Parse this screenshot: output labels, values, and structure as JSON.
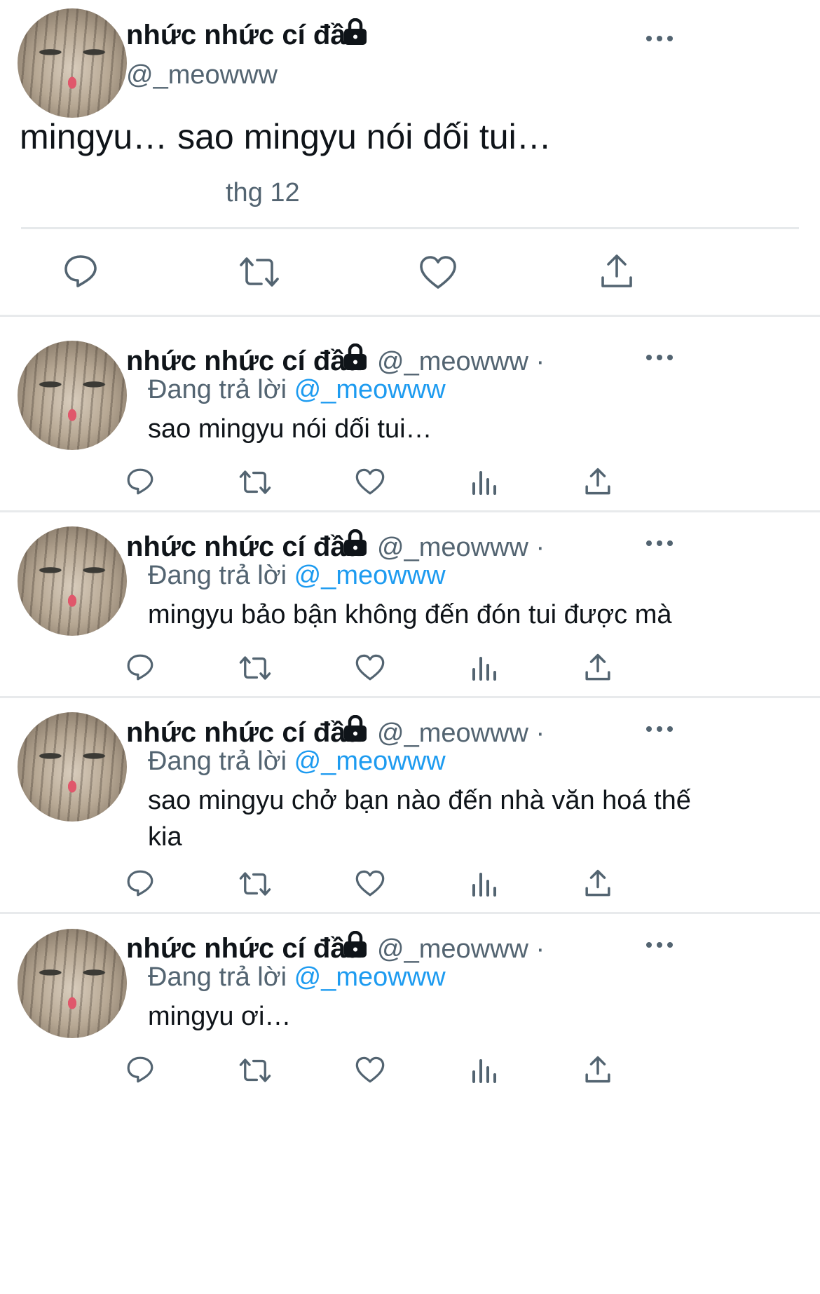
{
  "main_tweet": {
    "display_name": "nhức nhức cí đầu",
    "handle": "@_meowww",
    "text": "mingyu… sao mingyu nói dối tui…",
    "date": "thg 12"
  },
  "icons": {
    "reply": "reply-icon",
    "retweet": "retweet-icon",
    "like": "like-icon",
    "analytics": "analytics-icon",
    "share": "share-icon",
    "more": "more-icon",
    "lock": "lock-icon"
  },
  "replies": [
    {
      "display_name": "nhức nhức cí đầu",
      "handle": "@_meowww ·",
      "replying_to_label": "Đang trả lời",
      "replying_to_handle": "@_meowww",
      "text": "sao mingyu nói dối tui…"
    },
    {
      "display_name": "nhức nhức cí đầu",
      "handle": "@_meowww ·",
      "replying_to_label": "Đang trả lời",
      "replying_to_handle": "@_meowww",
      "text": "mingyu bảo bận không đến đón tui được mà"
    },
    {
      "display_name": "nhức nhức cí đầu",
      "handle": "@_meowww ·",
      "replying_to_label": "Đang trả lời",
      "replying_to_handle": "@_meowww",
      "text": "sao mingyu chở bạn nào đến nhà văn hoá thế kia"
    },
    {
      "display_name": "nhức nhức cí đầu",
      "handle": "@_meowww ·",
      "replying_to_label": "Đang trả lời",
      "replying_to_handle": "@_meowww",
      "text": "mingyu ơi…"
    }
  ],
  "colors": {
    "text": "#0f1419",
    "secondary": "#536471",
    "mention": "#1d9bf0",
    "divider": "#e6e9eb"
  }
}
